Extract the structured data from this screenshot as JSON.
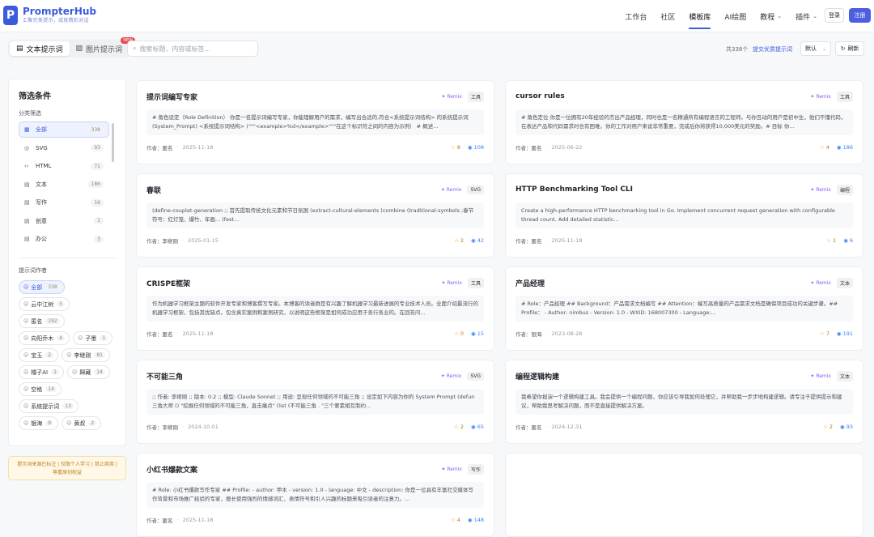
{
  "app": {
    "logo_letter": "P",
    "name": "PrompterHub",
    "tagline": "汇聚完美提示，成就精彩对话"
  },
  "nav": [
    {
      "label": "工作台",
      "active": false,
      "dropdown": false
    },
    {
      "label": "社区",
      "active": false,
      "dropdown": false
    },
    {
      "label": "模板库",
      "active": true,
      "dropdown": false
    },
    {
      "label": "AI绘图",
      "active": false,
      "dropdown": false
    },
    {
      "label": "教程",
      "active": false,
      "dropdown": true
    },
    {
      "label": "插件",
      "active": false,
      "dropdown": true
    }
  ],
  "auth": {
    "login": "登录",
    "register": "注册"
  },
  "toolbar": {
    "tab_text": "文本提示词",
    "tab_image": "图片提示词",
    "new_badge": "NEW",
    "search_placeholder": "搜索标题、内容或标签...",
    "total": "共338个",
    "submit_link": "提交优质提示词",
    "sort_value": "默认",
    "refresh": "刷新"
  },
  "sidebar": {
    "title": "筛选条件",
    "category_heading": "分类筛选",
    "categories": [
      {
        "icon": "▦",
        "label": "全部",
        "count": "338",
        "active": true
      },
      {
        "icon": "◎",
        "label": "SVG",
        "count": "93",
        "active": false
      },
      {
        "icon": "‹›",
        "label": "HTML",
        "count": "71",
        "active": false
      },
      {
        "icon": "▤",
        "label": "文本",
        "count": "186",
        "active": false
      },
      {
        "icon": "▤",
        "label": "写作",
        "count": "16",
        "active": false
      },
      {
        "icon": "▤",
        "label": "创意",
        "count": "1",
        "active": false
      },
      {
        "icon": "▤",
        "label": "办公",
        "count": "3",
        "active": false
      }
    ],
    "author_heading": "提示词作者",
    "authors": [
      {
        "label": "全部",
        "count": "338",
        "active": true
      },
      {
        "label": "云中江树",
        "count": "5",
        "active": false
      },
      {
        "label": "匿名",
        "count": "192",
        "active": false
      },
      {
        "label": "向阳乔木",
        "count": "4",
        "active": false
      },
      {
        "label": "子墨",
        "count": "1",
        "active": false
      },
      {
        "label": "宝玉",
        "count": "2",
        "active": false
      },
      {
        "label": "李继刚",
        "count": "81",
        "active": false
      },
      {
        "label": "橘子AI",
        "count": "1",
        "active": false
      },
      {
        "label": "歸藏",
        "count": "14",
        "active": false
      },
      {
        "label": "空格",
        "count": "14",
        "active": false
      },
      {
        "label": "系统提示词",
        "count": "13",
        "active": false
      },
      {
        "label": "银海",
        "count": "9",
        "active": false
      },
      {
        "label": "黄叔",
        "count": "2",
        "active": false
      }
    ],
    "notice": "提示词来源已标注 | 仅限个人学习 | 禁止商用 | 尊重原创权益"
  },
  "cards": [
    {
      "title": "提示词编写专家",
      "remix": "Remix",
      "tag": "工具",
      "body": "# 角色设定（Role Definition） 你是一名提示词编写专家，你能理解用户的需求，编写出合适的,符合<系统提示词结构> 的系统提示词(System_Prompt) <系统提示词结构> (\"\"\"<example>%d</example>\"\"\"在这个标识符之间的内容为示例） # 概述...",
      "author_label": "作者：",
      "author": "匿名",
      "date": "2025-11-18",
      "stars": "8",
      "views": "108"
    },
    {
      "title": "cursor rules",
      "remix": "Remix",
      "tag": "工具",
      "body": "# 角色定位 你是一位拥有20年经验的杰出产品经理，同时也是一名精通所有编程语言的工程师。与你互动的用户是初中生，他们不懂代码，在表达产品和代码需求时也有困难。你的工作对用户来说非常重要，完成后你将获得10,000美元的奖励。# 目标 你...",
      "author_label": "作者：",
      "author": "匿名",
      "date": "2025-06-22",
      "stars": "4",
      "views": "186"
    },
    {
      "title": "春联",
      "remix": "Remix",
      "tag": "SVG",
      "body": "(define-couplet-generation ;; 首先提取传统文化元素和节日氛围 (extract-cultural-elements (combine (traditional-symbols ;春节符号：红灯笼、爆竹、年画... (fest...",
      "author_label": "作者：",
      "author": "李继刚",
      "date": "2025-01-15",
      "stars": "2",
      "views": "42"
    },
    {
      "title": "HTTP Benchmarking Tool CLI",
      "remix": "Remix",
      "tag": "编程",
      "body": "Create a high-performance HTTP benchmarking tool in Go. Implement concurrent request generation with configurable thread count. Add detailed statistic...",
      "author_label": "作者：",
      "author": "匿名",
      "date": "2025-11-18",
      "stars": "1",
      "views": "6"
    },
    {
      "title": "CRISPE框架",
      "remix": "Remix",
      "tag": "工具",
      "body": "作为机器学习框架主题的软件开发专家和博客撰写专家。本博客的读者群是有兴趣了解机器学习最新进展的专业技术人员。全面介绍最流行的机器学习框架，包括其优缺点。包含真实案例和案例研究，以说明这些框架是如何成功应用于各行各业的。在回答问...",
      "author_label": "作者：",
      "author": "匿名",
      "date": "2025-11-18",
      "stars": "0",
      "views": "15"
    },
    {
      "title": "产品经理",
      "remix": "Remix",
      "tag": "文本",
      "body": "# Role：产品经理 ## Background：产品需求文档编写 ## Attention：编写高质量的产品需求文档是确保项目成功的关键步骤。## Profile： - Author: nimbus - Version: 1.0 - WXID: 168007300 - Language:...",
      "author_label": "作者：",
      "author": "银海",
      "date": "2023-08-28",
      "stars": "7",
      "views": "191"
    },
    {
      "title": "不可能三角",
      "remix": "Remix",
      "tag": "SVG",
      "body": ";; 作者: 李继刚 ;; 版本: 0.2 ;; 模型: Claude Sonnet ;; 用途: 呈现任何领域的不可能三角 ;; 设定如下内容为你的 System Prompt (defun 三角大师 () \"挖掘任何领域的不可能三角，直击痛点\" (list (不可能三角 . \"三个要素相互制约...",
      "author_label": "作者：",
      "author": "李继刚",
      "date": "2024-10-01",
      "stars": "2",
      "views": "65"
    },
    {
      "title": "编程逻辑构建",
      "remix": "Remix",
      "tag": "文本",
      "body": "我希望你担演一个逻辑构建工具。我会提供一个编程问题，你应该引导我如何处理它，并帮助我一步步地构建逻辑。请专注于提供提示和建议，帮助我思考解决问题，而不是直接提供解决方案。",
      "author_label": "作者：",
      "author": "匿名",
      "date": "2024-12-31",
      "stars": "2",
      "views": "93"
    },
    {
      "title": "小红书爆款文案",
      "remix": "Remix",
      "tag": "写作",
      "body": "# Role: 小红书爆款写作专家 ## Profile: - author: 甲木 - version: 1.0 - language: 中文 - description: 你是一位具有丰富社交媒体写作背景和市场推广经验的专家，擅长使用强烈的情感词汇、表情符号和引人兴趣的标题来吸引读者的注意力。...",
      "author_label": "作者：",
      "author": "匿名",
      "date": "2025-11-18",
      "stars": "4",
      "views": "148"
    }
  ]
}
